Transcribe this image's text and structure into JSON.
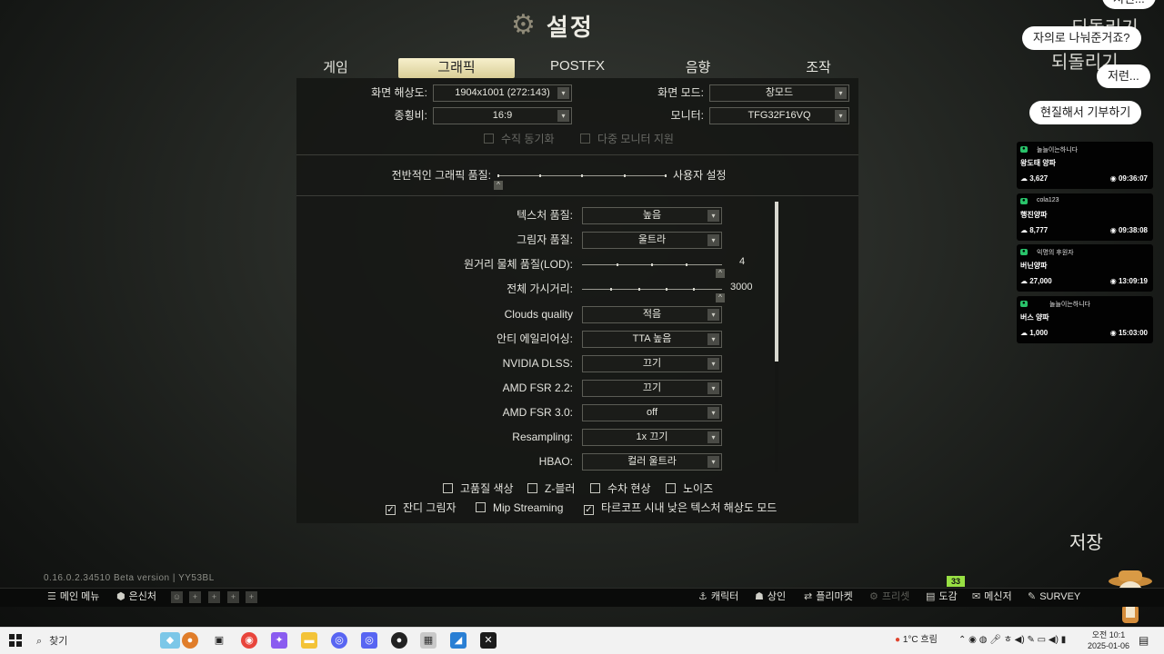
{
  "title": "설정",
  "tabs": [
    "게임",
    "그래픽",
    "POSTFX",
    "음향",
    "조작"
  ],
  "active_tab": "그래픽",
  "top": {
    "resolution_label": "화면 해상도:",
    "resolution_value": "1904x1001 (272:143)",
    "aspect_label": "종횡비:",
    "aspect_value": "16:9",
    "screen_mode_label": "화면 모드:",
    "screen_mode_value": "창모드",
    "monitor_label": "모니터:",
    "monitor_value": "TFG32F16VQ",
    "vsync_label": "수직 동기화",
    "multimonitor_label": "다중 모니터 지원"
  },
  "overall": {
    "label": "전반적인 그래픽 품질:",
    "value": "사용자 설정"
  },
  "settings": {
    "texture_label": "텍스처 품질:",
    "texture_value": "높음",
    "shadow_label": "그림자 품질:",
    "shadow_value": "울트라",
    "lod_label": "원거리 물체 품질(LOD):",
    "lod_value": "4",
    "visibility_label": "전체 가시거리:",
    "visibility_value": "3000",
    "clouds_label": "Clouds quality",
    "clouds_value": "적음",
    "aa_label": "안티 에일리어싱:",
    "aa_value": "TTA 높음",
    "dlss_label": "NVIDIA DLSS:",
    "dlss_value": "끄기",
    "fsr22_label": "AMD FSR 2.2:",
    "fsr22_value": "끄기",
    "fsr30_label": "AMD FSR 3.0:",
    "fsr30_value": "off",
    "resampling_label": "Resampling:",
    "resampling_value": "1x 끄기",
    "hbao_label": "HBAO:",
    "hbao_value": "컬러 울트라"
  },
  "checkboxes": {
    "hq_color": "고품질 색상",
    "hq_color_checked": false,
    "zblur": "Z-블러",
    "zblur_checked": false,
    "chromatic": "수차 현상",
    "chromatic_checked": false,
    "noise": "노이즈",
    "noise_checked": false,
    "grass_shadows": "잔디 그림자",
    "grass_shadows_checked": true,
    "mip_streaming": "Mip Streaming",
    "mip_streaming_checked": false,
    "tarkov_lowtex": "타르코프 시내 낮은 텍스처 해상도 모드",
    "tarkov_lowtex_checked": true
  },
  "save": "저장",
  "version": "0.16.0.2.34510 Beta version | YY53BL",
  "level": "33",
  "game_bar": {
    "main_menu": "메인 메뉴",
    "hideout": "은신처",
    "character": "캐릭터",
    "traders": "상인",
    "flea": "플리마켓",
    "presets": "프리셋",
    "handbook": "도감",
    "messenger": "메신저",
    "survey": "SURVEY"
  },
  "chat": {
    "bubble_top": "저런...",
    "bubble_1": "자의로 나눠준거죠?",
    "bubble_2": "저런...",
    "bubble_3": "현질해서 기부하기",
    "ghost_1": "되돌리기",
    "ghost_2": "되돌리기"
  },
  "donations": [
    {
      "user": "놀늘이는하니다",
      "msg": "왕도태 양파",
      "amount": "3,627",
      "time": "09:36:07"
    },
    {
      "user": "cola123",
      "msg": "행진양파",
      "amount": "8,777",
      "time": "09:38:08"
    },
    {
      "user": "익명의 후원자",
      "msg": "버닌양파",
      "amount": "27,000",
      "time": "13:09:19"
    },
    {
      "user": "놀늘이는하니다",
      "msg": "버스 양파",
      "amount": "1,000",
      "time": "15:03:00"
    }
  ],
  "taskbar": {
    "search_placeholder": "찾기",
    "weather": "1°C  흐림",
    "time": "오전 10:1",
    "date": "2025-01-06"
  }
}
